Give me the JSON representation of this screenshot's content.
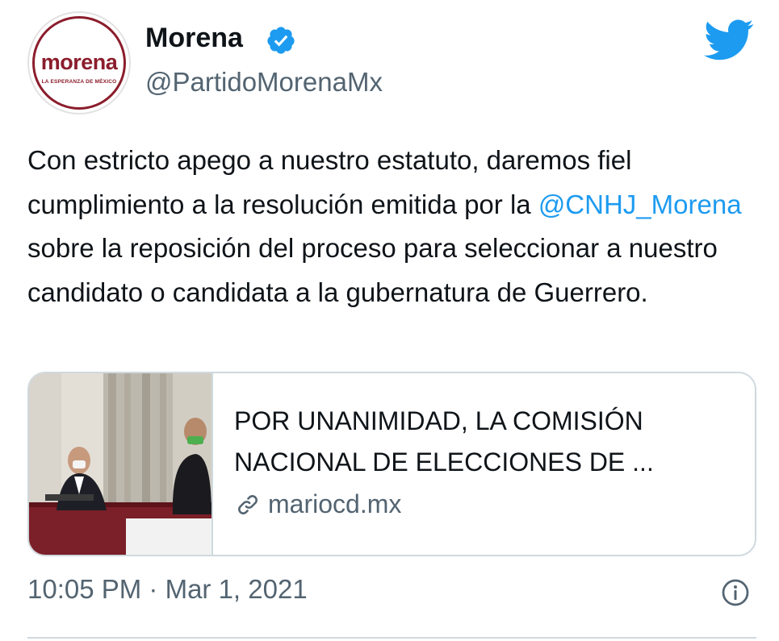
{
  "author": {
    "name": "Morena",
    "handle": "@PartidoMorenaMx",
    "avatar_wordmark": "morena",
    "avatar_tagline": "LA ESPERANZA DE MÉXICO",
    "verified_icon": "verified-badge-icon"
  },
  "brand_icon": "twitter-bird-icon",
  "tweet": {
    "text_part1": "Con estricto apego a nuestro estatuto, daremos fiel cumplimiento a la resolución emitida por la ",
    "mention": "@CNHJ_Morena",
    "text_part2": " sobre la reposición del proceso para seleccionar a nuestro candidato o candidata a la gubernatura de Guerrero."
  },
  "card": {
    "title": "POR UNANIMIDAD, LA COMISIÓN NACIONAL DE ELECCIONES DE ...",
    "domain": "mariocd.mx",
    "link_icon": "link-icon"
  },
  "timestamp": "10:05 PM · Mar 1, 2021",
  "info_icon": "info-icon",
  "colors": {
    "text": "#0f1419",
    "secondary": "#536471",
    "accent": "#1d9bf0",
    "brand": "#8b1d2c",
    "border": "#cfd9de"
  }
}
